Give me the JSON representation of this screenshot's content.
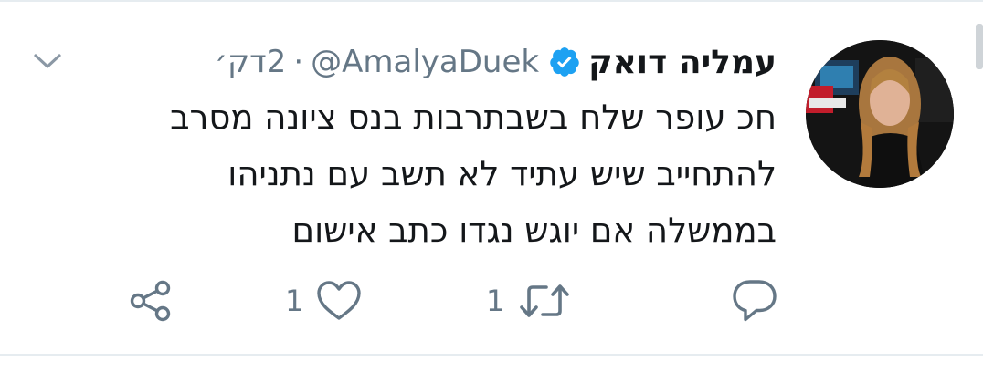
{
  "tweet": {
    "display_name": "עמליה דואק",
    "handle": "@AmalyaDuek",
    "separator": "·",
    "time": "2דק׳",
    "body_lines": [
      "חכ עופר שלח בשבתרבות בנס ציונה מסרב",
      "להתחייב שיש עתיד לא תשב עם נתניהו",
      "בממשלה אם יוגש נגדו כתב אישום"
    ],
    "verified_icon": "verified-badge-icon",
    "caret_icon": "chevron-down-icon"
  },
  "actions": {
    "reply": {
      "icon": "reply-icon"
    },
    "retweet": {
      "icon": "retweet-icon",
      "count": "1"
    },
    "like": {
      "icon": "heart-icon",
      "count": "1"
    },
    "share": {
      "icon": "share-icon"
    }
  },
  "colors": {
    "text": "#14171a",
    "secondary": "#657786",
    "verified": "#1da1f2",
    "divider": "#e6ecf0"
  }
}
